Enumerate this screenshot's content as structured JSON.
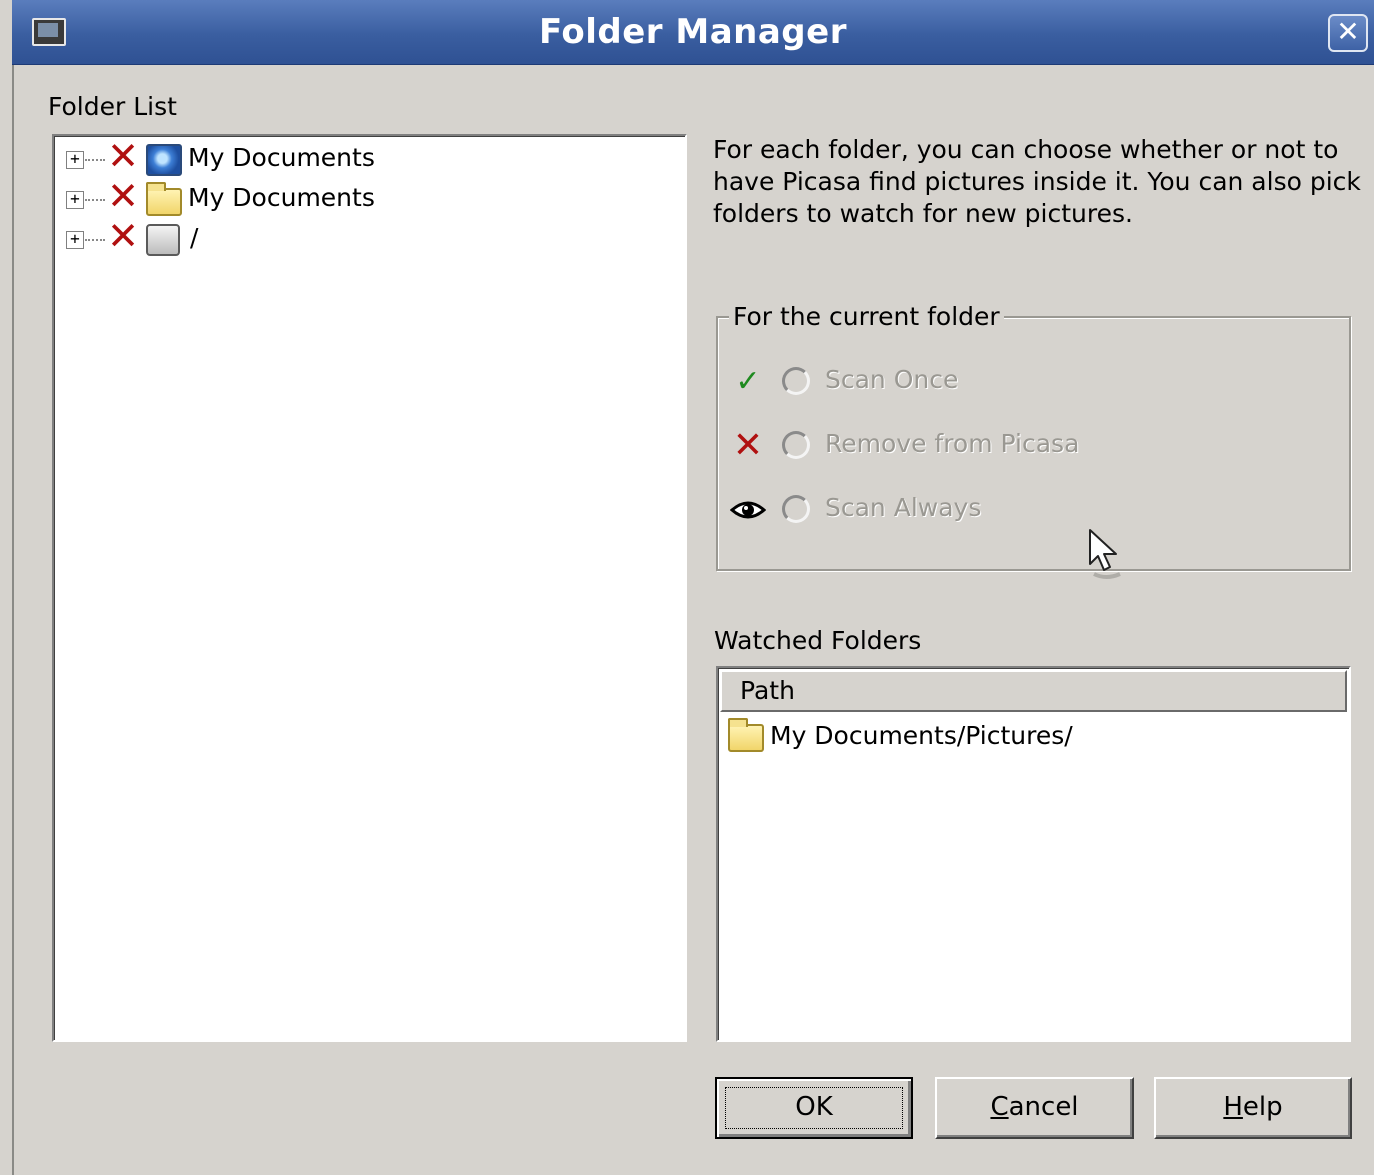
{
  "window": {
    "title": "Folder Manager",
    "close_glyph": "✕"
  },
  "folder_list": {
    "label": "Folder List",
    "items": [
      {
        "expander": "+",
        "status_icon": "remove-x-icon",
        "type_icon": "my-documents-globe-icon",
        "label": "My Documents"
      },
      {
        "expander": "+",
        "status_icon": "remove-x-icon",
        "type_icon": "folder-icon",
        "label": "My Documents"
      },
      {
        "expander": "+",
        "status_icon": "remove-x-icon",
        "type_icon": "drive-icon",
        "label": "/"
      }
    ]
  },
  "description": "For each folder, you can choose whether or not to have Picasa find pictures inside it.  You can also pick folders to watch for new pictures.",
  "current_folder": {
    "group_label": "For the current folder",
    "options": [
      {
        "icon": "checkmark-icon",
        "glyph": "✓",
        "label": "Scan Once",
        "selected": false,
        "enabled": false
      },
      {
        "icon": "remove-x-icon",
        "glyph": "✕",
        "label": "Remove from Picasa",
        "selected": false,
        "enabled": false
      },
      {
        "icon": "eye-icon",
        "glyph": "👁",
        "label": "Scan Always",
        "selected": false,
        "enabled": false
      }
    ]
  },
  "watched_folders": {
    "label": "Watched Folders",
    "column_header": "Path",
    "rows": [
      {
        "icon": "folder-icon",
        "path": "My Documents/Pictures/"
      }
    ]
  },
  "buttons": {
    "ok": "OK",
    "cancel_first": "C",
    "cancel_rest": "ancel",
    "help_first": "H",
    "help_rest": "elp"
  },
  "colors": {
    "titlebar": "#3a5ea0",
    "dialog_bg": "#d6d3ce",
    "remove_red": "#b01010",
    "check_green": "#1f8a1f",
    "disabled_text": "#9a9892"
  }
}
